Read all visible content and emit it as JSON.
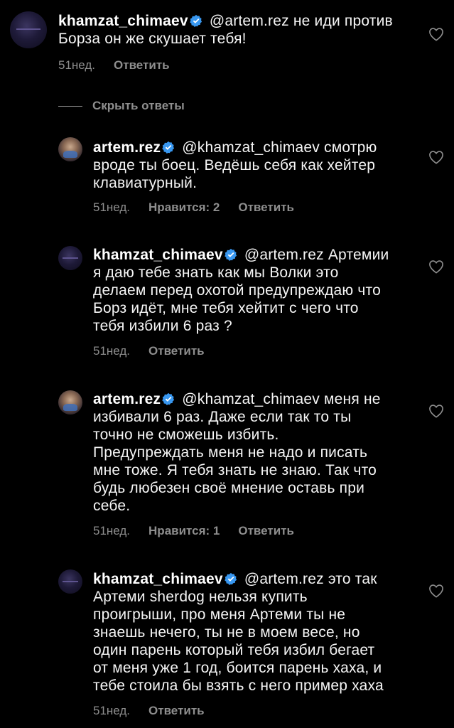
{
  "comments": [
    {
      "username": "khamzat_chimaev",
      "lines": [
        "@artem.rez не иди против",
        "Борза он же скушает тебя!"
      ],
      "time": "51нед.",
      "likes": "",
      "reply": "Ответить"
    },
    {
      "username": "artem.rez",
      "lines": [
        "@khamzat_chimaev смотрю",
        "вроде ты боец. Ведёшь себя как хейтер",
        "клавиатурный."
      ],
      "time": "51нед.",
      "likes": "Нравится: 2",
      "reply": "Ответить"
    },
    {
      "username": "khamzat_chimaev",
      "lines": [
        "@artem.rez Артемии",
        "я даю тебе знать как мы Волки это",
        "делаем перед охотой предупреждаю что",
        "Борз идёт, мне тебя хейтит с чего что",
        "тебя избили 6 раз ?"
      ],
      "time": "51нед.",
      "likes": "",
      "reply": "Ответить"
    },
    {
      "username": "artem.rez",
      "lines": [
        "@khamzat_chimaev меня не",
        "избивали 6 раз. Даже если так то ты",
        "точно не сможешь избить.",
        "Предупреждать меня не надо и писать",
        "мне тоже. Я тебя знать не знаю. Так что",
        "будь любезен своё мнение оставь при",
        "себе."
      ],
      "time": "51нед.",
      "likes": "Нравится: 1",
      "reply": "Ответить"
    },
    {
      "username": "khamzat_chimaev",
      "lines": [
        "@artem.rez это так",
        "Артеми sherdog нельзя купить",
        "проигрыши, про меня Артеми ты не",
        "знаешь нечего, ты не в моем весе, но",
        "один парень который тебя избил бегает",
        "от меня уже 1 год, боится парень хаха, и",
        "тебе стоила бы взять с него пример хаха"
      ],
      "time": "51нед.",
      "likes": "",
      "reply": "Ответить"
    }
  ],
  "hide_replies": "Скрыть ответы",
  "icons": {
    "verified": "verified-badge-icon",
    "like": "heart-outline-icon"
  },
  "colors": {
    "background": "#000000",
    "text": "#f5f5f5",
    "secondary": "#8e8e8e",
    "verified": "#3897f0"
  }
}
